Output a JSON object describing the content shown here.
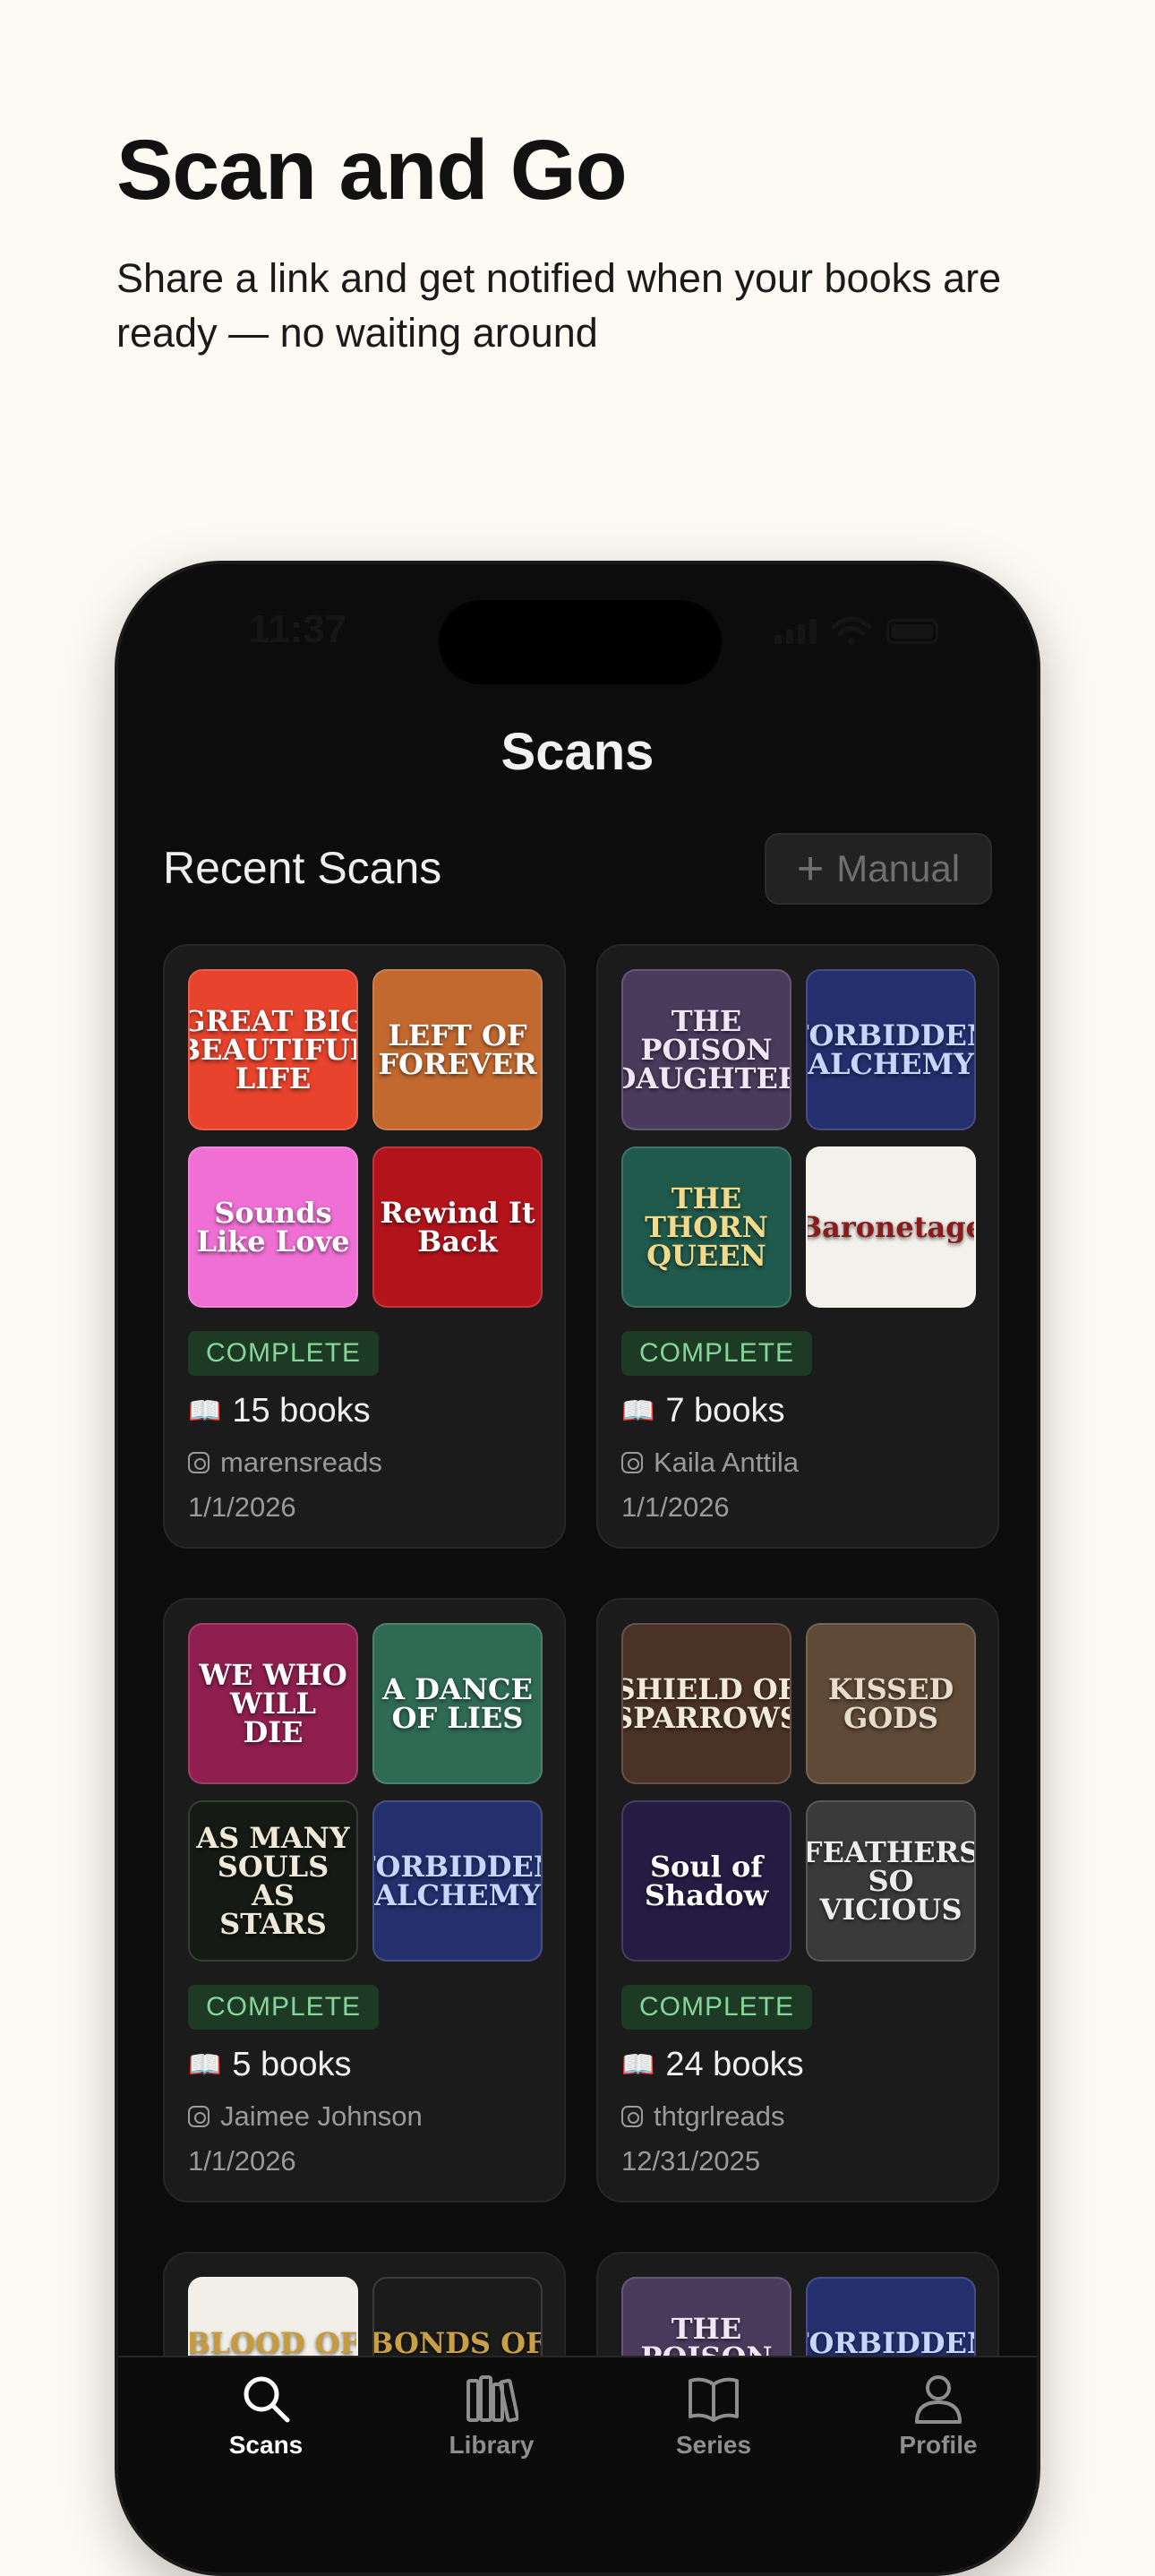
{
  "hero": {
    "title": "Scan and Go",
    "subtitle": "Share a link and get notified when your books are ready — no waiting around"
  },
  "status": {
    "time": "11:37"
  },
  "header": {
    "title": "Scans"
  },
  "section": {
    "title": "Recent Scans",
    "manual_label": "Manual"
  },
  "scans": [
    {
      "status": "COMPLETE",
      "count": "15 books",
      "user": "marensreads",
      "date": "1/1/2026",
      "covers": [
        {
          "title": "GREAT BIG BEAUTIFUL LIFE",
          "bg": "#e8432c",
          "fg": "#ffffff"
        },
        {
          "title": "LEFT OF FOREVER",
          "bg": "#c2692f",
          "fg": "#ffffff"
        },
        {
          "title": "Sounds Like Love",
          "bg": "#f06fd4",
          "fg": "#ffffff"
        },
        {
          "title": "Rewind It Back",
          "bg": "#b3141b",
          "fg": "#ffffff"
        }
      ]
    },
    {
      "status": "COMPLETE",
      "count": "7 books",
      "user": "Kaila Anttila",
      "date": "1/1/2026",
      "covers": [
        {
          "title": "THE POISON DAUGHTER",
          "bg": "#4a3a5c",
          "fg": "#f1e6f5"
        },
        {
          "title": "FORBIDDEN ALCHEMY",
          "bg": "#24306e",
          "fg": "#c8d6ff"
        },
        {
          "title": "THE THORN QUEEN",
          "bg": "#1f5a4c",
          "fg": "#f3d98a"
        },
        {
          "title": "Baronetage",
          "bg": "#f3f1ec",
          "fg": "#8a1b1b"
        }
      ]
    },
    {
      "status": "COMPLETE",
      "count": "5 books",
      "user": "Jaimee Johnson",
      "date": "1/1/2026",
      "covers": [
        {
          "title": "WE WHO WILL DIE",
          "bg": "#8f1f4e",
          "fg": "#ffffff"
        },
        {
          "title": "A DANCE OF LIES",
          "bg": "#2f6a55",
          "fg": "#ffffff"
        },
        {
          "title": "AS MANY SOULS AS STARS",
          "bg": "#151a14",
          "fg": "#f1e9d8"
        },
        {
          "title": "FORBIDDEN ALCHEMY",
          "bg": "#24306e",
          "fg": "#c8d6ff"
        }
      ]
    },
    {
      "status": "COMPLETE",
      "count": "24 books",
      "user": "thtgrlreads",
      "date": "12/31/2025",
      "covers": [
        {
          "title": "SHIELD OF SPARROWS",
          "bg": "#4a3326",
          "fg": "#f4eadc"
        },
        {
          "title": "KISSED GODS",
          "bg": "#5e4a37",
          "fg": "#e8dccb"
        },
        {
          "title": "Soul of Shadow",
          "bg": "#251c44",
          "fg": "#ffffff"
        },
        {
          "title": "FEATHERS SO VICIOUS",
          "bg": "#3a3a3a",
          "fg": "#eeeeee"
        }
      ]
    },
    {
      "covers": [
        {
          "title": "BLOOD OF HERCULES",
          "bg": "#f1efe8",
          "fg": "#c79a3a"
        },
        {
          "title": "BONDS OF HERCULES",
          "bg": "#1b1b1b",
          "fg": "#c9a044"
        }
      ]
    },
    {
      "covers": [
        {
          "title": "THE POISON DAUGHTER",
          "bg": "#4a3a5c",
          "fg": "#f1e6f5"
        },
        {
          "title": "FORBIDDEN ALCHEMY",
          "bg": "#24306e",
          "fg": "#c8d6ff"
        }
      ]
    }
  ],
  "tabs": [
    {
      "label": "Scans",
      "icon": "search-icon",
      "active": true
    },
    {
      "label": "Library",
      "icon": "library-icon",
      "active": false
    },
    {
      "label": "Series",
      "icon": "book-open-icon",
      "active": false
    },
    {
      "label": "Profile",
      "icon": "person-icon",
      "active": false
    }
  ]
}
